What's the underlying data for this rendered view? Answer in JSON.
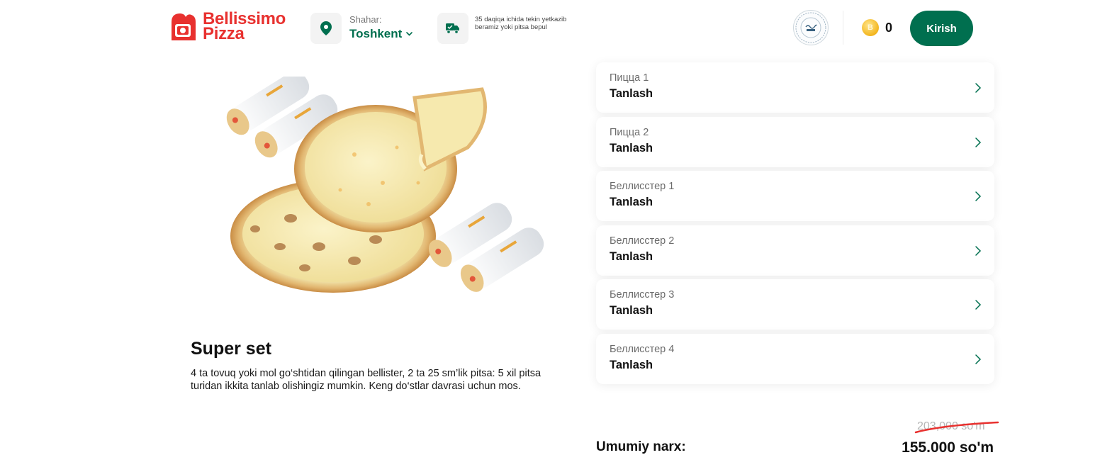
{
  "brand": {
    "name_line1": "Bellissimo",
    "name_line2": "Pizza",
    "color": "#e8312f"
  },
  "header": {
    "city_label": "Shahar:",
    "city_value": "Toshkent",
    "delivery_text": "35 daqiqa ichida tekin yetkazib beramiz yoki pitsa bepul",
    "coins": "0",
    "login_label": "Kirish",
    "accent_color": "#006f4f",
    "icons": [
      "location-pin-icon",
      "chevron-down-icon",
      "delivery-truck-icon",
      "halal-badge-icon",
      "coin-icon"
    ]
  },
  "product": {
    "title": "Super set",
    "description": "4 ta tovuq yoki mol go‘shtidan qilingan bellister, 2 ta 25 sm’lik pitsa: 5 xil pitsa turidan ikkita tanlab olishingiz mumkin. Keng do‘stlar davrasi uchun mos."
  },
  "choices": [
    {
      "label": "Пицца 1",
      "value": "Tanlash"
    },
    {
      "label": "Пицца 2",
      "value": "Tanlash"
    },
    {
      "label": "Беллисстер 1",
      "value": "Tanlash"
    },
    {
      "label": "Беллисстер 2",
      "value": "Tanlash"
    },
    {
      "label": "Беллисстер 3",
      "value": "Tanlash"
    },
    {
      "label": "Беллисстер 4",
      "value": "Tanlash"
    }
  ],
  "total": {
    "label": "Umumiy narx:",
    "old_price": "203,000 so'm",
    "new_price": "155.000 so'm"
  }
}
